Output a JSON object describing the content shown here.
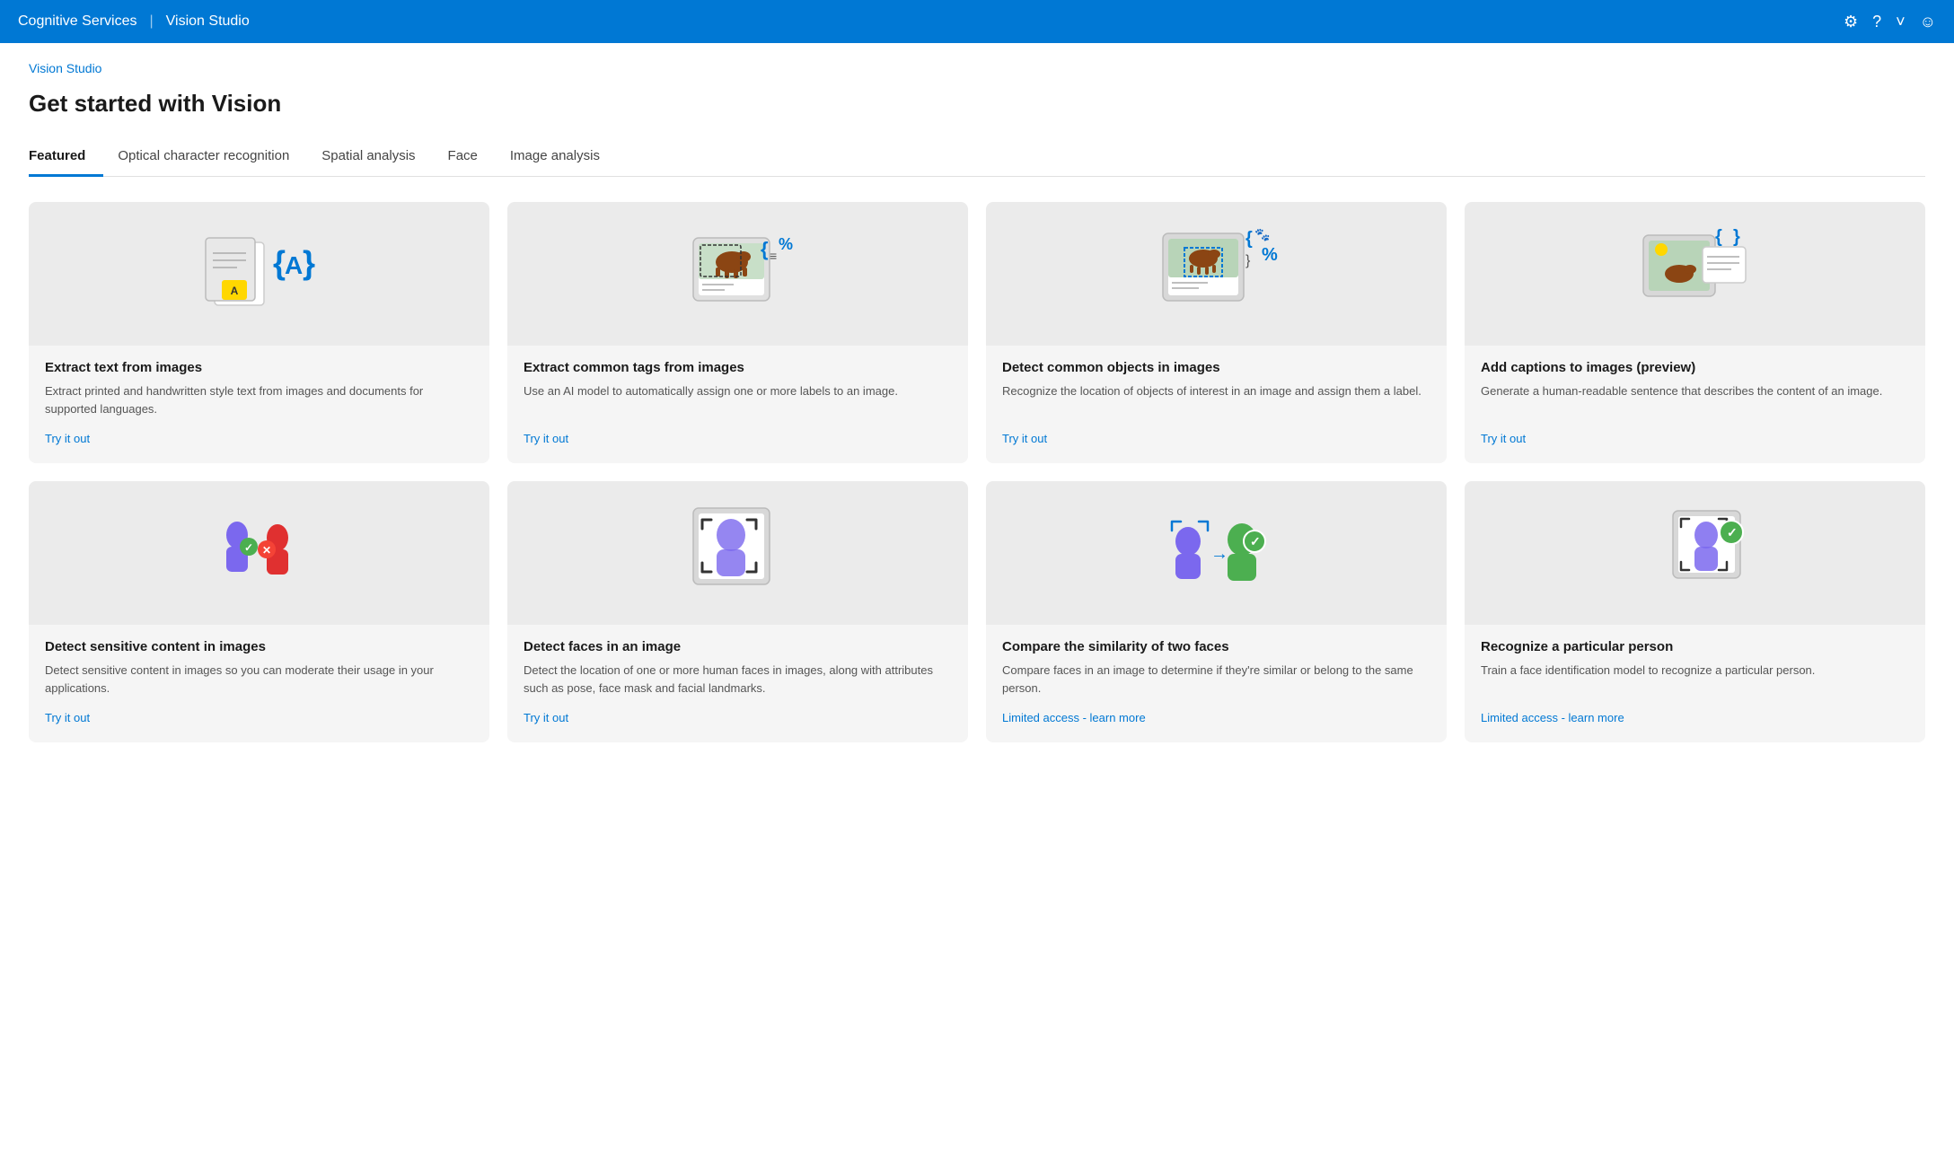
{
  "topnav": {
    "brand": "Cognitive Services",
    "divider": "|",
    "product": "Vision Studio",
    "icons": {
      "settings": "⚙",
      "help": "?",
      "chevron": "˅",
      "user": "☺"
    }
  },
  "breadcrumb": "Vision Studio",
  "page_title": "Get started with Vision",
  "tabs": [
    {
      "id": "featured",
      "label": "Featured",
      "active": true
    },
    {
      "id": "ocr",
      "label": "Optical character recognition",
      "active": false
    },
    {
      "id": "spatial",
      "label": "Spatial analysis",
      "active": false
    },
    {
      "id": "face",
      "label": "Face",
      "active": false
    },
    {
      "id": "image",
      "label": "Image analysis",
      "active": false
    }
  ],
  "cards_row1": [
    {
      "id": "extract-text",
      "title": "Extract text from images",
      "desc": "Extract printed and handwritten style text from images and documents for supported languages.",
      "link": "Try it out",
      "link_type": "try"
    },
    {
      "id": "extract-tags",
      "title": "Extract common tags from images",
      "desc": "Use an AI model to automatically assign one or more labels to an image.",
      "link": "Try it out",
      "link_type": "try"
    },
    {
      "id": "detect-objects",
      "title": "Detect common objects in images",
      "desc": "Recognize the location of objects of interest in an image and assign them a label.",
      "link": "Try it out",
      "link_type": "try"
    },
    {
      "id": "add-captions",
      "title": "Add captions to images (preview)",
      "desc": "Generate a human-readable sentence that describes the content of an image.",
      "link": "Try it out",
      "link_type": "try"
    }
  ],
  "cards_row2": [
    {
      "id": "detect-sensitive",
      "title": "Detect sensitive content in images",
      "desc": "Detect sensitive content in images so you can moderate their usage in your applications.",
      "link": "Try it out",
      "link_type": "try"
    },
    {
      "id": "detect-faces",
      "title": "Detect faces in an image",
      "desc": "Detect the location of one or more human faces in images, along with attributes such as pose, face mask and facial landmarks.",
      "link": "Try it out",
      "link_type": "try"
    },
    {
      "id": "compare-faces",
      "title": "Compare the similarity of two faces",
      "desc": "Compare faces in an image to determine if they're similar or belong to the same person.",
      "link": "Limited access - learn more",
      "link_type": "limited"
    },
    {
      "id": "recognize-person",
      "title": "Recognize a particular person",
      "desc": "Train a face identification model to recognize a particular person.",
      "link": "Limited access - learn more",
      "link_type": "limited"
    }
  ]
}
